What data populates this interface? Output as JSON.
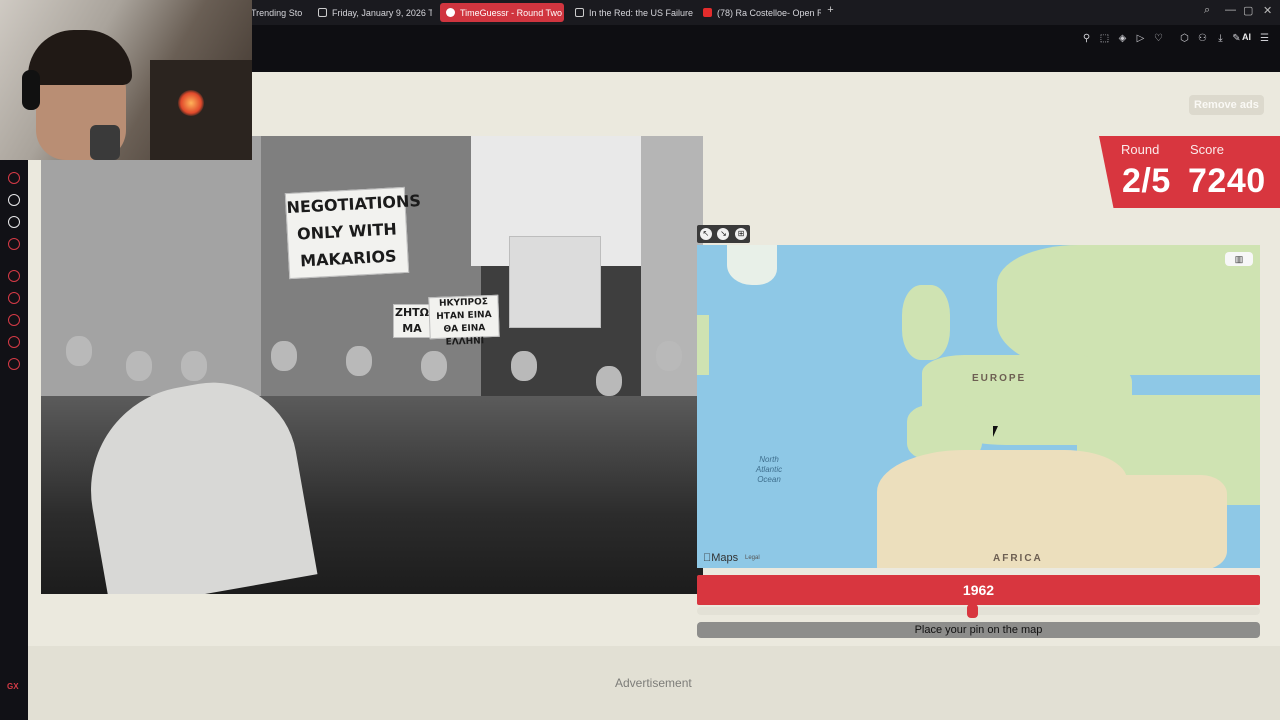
{
  "browser": {
    "tabs": [
      {
        "label": "Trending Sto",
        "icon": "news-icon"
      },
      {
        "label": "Friday, January 9, 2026 T",
        "icon": "calendar-icon"
      },
      {
        "label": "TimeGuessr - Round Two",
        "icon": "timeguessr-icon",
        "active": true
      },
      {
        "label": "In the Red: the US Failure",
        "icon": "document-icon"
      },
      {
        "label": "(78) Ra Costelloe- Open R",
        "icon": "youtube-icon"
      }
    ],
    "new_tab": "+",
    "ai_label": "AI"
  },
  "sidebar_badge": "GX",
  "page": {
    "remove_ads": "Remove ads",
    "round_label": "Round",
    "round_value": "2/5",
    "score_label": "Score",
    "score_value": "7240",
    "photo_signs": {
      "sign1": "NEGOTIATIONS ONLY WITH MAKARIOS",
      "sign2": "ΖΗΤΩ ΜΑ",
      "sign3": "ΗΚΥΠΡΟΣ ΗΤΑΝ ΕΙΝΑ ΘΑ ΕΙΝΑ ΕΛΛΗΝΙ"
    },
    "map": {
      "label_europe": "EUROPE",
      "label_africa": "AFRICA",
      "label_ocean": "North Atlantic Ocean",
      "maps_logo": "Maps",
      "legal": "Legal"
    },
    "year": {
      "value": "1962",
      "slider_fraction": 0.49
    },
    "pin_prompt": "Place your pin on the map",
    "advertisement": "Advertisement"
  },
  "colors": {
    "accent": "#d8363f",
    "page_bg": "#ebe9de",
    "ocean": "#8ec8e6"
  }
}
